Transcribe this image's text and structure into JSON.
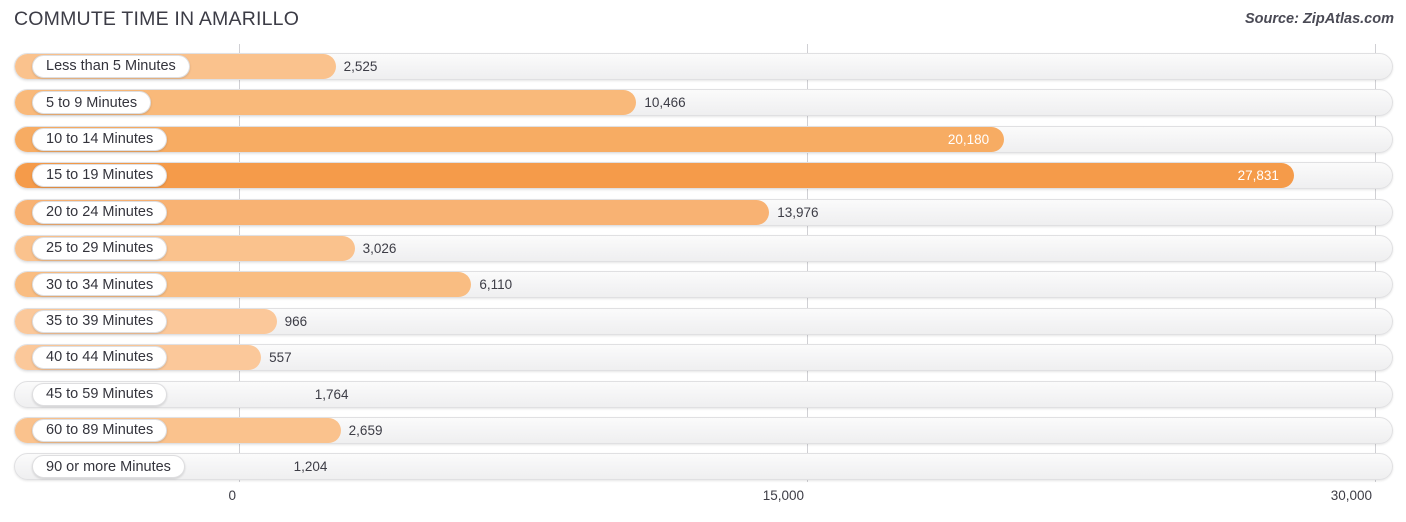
{
  "header": {
    "title": "COMMUTE TIME IN AMARILLO",
    "source": "Source: ZipAtlas.com"
  },
  "colors": {
    "bar_light": "#FAC characteristics",
    "track_bg": "#F4F4F5",
    "text": "#3D3D46"
  },
  "chart_data": {
    "type": "bar",
    "orientation": "horizontal",
    "title": "COMMUTE TIME IN AMARILLO",
    "xlabel": "",
    "ylabel": "",
    "xlim": [
      0,
      30000
    ],
    "grid": true,
    "legend": null,
    "tick_labels": [
      "0",
      "15,000",
      "30,000"
    ],
    "ticks": [
      0,
      15000,
      30000
    ],
    "categories": [
      "Less than 5 Minutes",
      "5 to 9 Minutes",
      "10 to 14 Minutes",
      "15 to 19 Minutes",
      "20 to 24 Minutes",
      "25 to 29 Minutes",
      "30 to 34 Minutes",
      "35 to 39 Minutes",
      "40 to 44 Minutes",
      "45 to 59 Minutes",
      "60 to 89 Minutes",
      "90 or more Minutes"
    ],
    "values": [
      2525,
      10466,
      20180,
      27831,
      13976,
      3026,
      6110,
      966,
      557,
      1764,
      2659,
      1204
    ],
    "value_labels": [
      "2,525",
      "10,466",
      "20,180",
      "27,831",
      "13,976",
      "3,026",
      "6,110",
      "966",
      "557",
      "1,764",
      "2,659",
      "1,204"
    ],
    "bar_colors": [
      "#FAC28D",
      "#F9B madness",
      "#F6A council",
      "#F59B4A",
      "#F8AE6A",
      "#FAC28D",
      "#F9BA7C",
      "#FBC89A",
      "#FBC89A",
      "#FAC architectural",
      "#FAC28D",
      "#FAC architectural"
    ]
  },
  "rows": [
    {
      "label": "Less than 5 Minutes",
      "value": 2525,
      "value_label": "2,525",
      "pill_width": 178,
      "color": "#FAC28D",
      "inside": false
    },
    {
      "label": "5 to 9 Minutes",
      "value": 10466,
      "value_label": "10,466",
      "pill_width": 144,
      "color": "#F9B97A",
      "inside": false
    },
    {
      "label": "10 to 14 Minutes",
      "value": 20180,
      "value_label": "20,180",
      "pill_width": 163,
      "color": "#F7AC63",
      "inside": true
    },
    {
      "label": "15 to 19 Minutes",
      "value": 27831,
      "value_label": "27,831",
      "pill_width": 163,
      "color": "#F59B4A",
      "inside": true
    },
    {
      "label": "20 to 24 Minutes",
      "value": 13976,
      "value_label": "13,976",
      "pill_width": 163,
      "color": "#F8B273",
      "inside": false
    },
    {
      "label": "25 to 29 Minutes",
      "value": 3026,
      "value_label": "3,026",
      "pill_width": 163,
      "color": "#FAC28D",
      "inside": false
    },
    {
      "label": "30 to 34 Minutes",
      "value": 6110,
      "value_label": "6,110",
      "pill_width": 163,
      "color": "#F9BD82",
      "inside": false
    },
    {
      "label": "35 to 39 Minutes",
      "value": 966,
      "value_label": "966",
      "pill_width": 163,
      "color": "#FBC89A",
      "inside": false
    },
    {
      "label": "40 to 44 Minutes",
      "value": 557,
      "value_label": "557",
      "pill_width": 163,
      "color": "#FBC89A",
      "inside": false
    },
    {
      "label": "45 to 59 Minutes",
      "value": 1764,
      "value_label": "1,764",
      "pill_width": 163,
      "color": "#FAC architectural",
      "inside": false
    },
    {
      "label": "60 to 89 Minutes",
      "value": 2659,
      "value_label": "2,659",
      "pill_width": 163,
      "color": "#FAC28D",
      "inside": false
    },
    {
      "label": "90 or more Minutes",
      "value": 1204,
      "value_label": "1,204",
      "pill_width": 182,
      "color": "#FAC architectural",
      "inside": false
    }
  ],
  "axis": {
    "ticks": [
      {
        "label": "0",
        "value": 0
      },
      {
        "label": "15,000",
        "value": 15000
      },
      {
        "label": "30,000",
        "value": 30000
      }
    ]
  }
}
